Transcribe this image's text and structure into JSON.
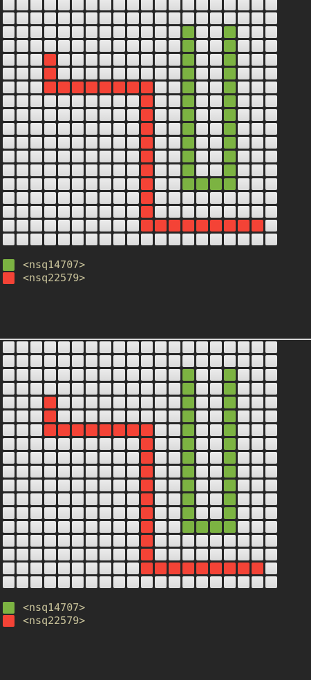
{
  "board": {
    "cols": 20,
    "rows": 18,
    "empty_color": "#e4e4e4"
  },
  "players": [
    {
      "label": "<nsq14707>",
      "color": "#7cb342",
      "cells": [
        [
          13,
          2
        ],
        [
          13,
          3
        ],
        [
          13,
          4
        ],
        [
          13,
          5
        ],
        [
          13,
          6
        ],
        [
          13,
          7
        ],
        [
          13,
          8
        ],
        [
          13,
          9
        ],
        [
          13,
          10
        ],
        [
          13,
          11
        ],
        [
          13,
          12
        ],
        [
          13,
          13
        ],
        [
          14,
          13
        ],
        [
          15,
          13
        ],
        [
          16,
          13
        ],
        [
          16,
          12
        ],
        [
          16,
          11
        ],
        [
          16,
          10
        ],
        [
          16,
          9
        ],
        [
          16,
          8
        ],
        [
          16,
          7
        ],
        [
          16,
          6
        ],
        [
          16,
          5
        ],
        [
          16,
          4
        ],
        [
          16,
          3
        ],
        [
          16,
          2
        ]
      ]
    },
    {
      "label": "<nsq22579>",
      "color": "#f44336",
      "cells": [
        [
          3,
          4
        ],
        [
          3,
          5
        ],
        [
          3,
          6
        ],
        [
          4,
          6
        ],
        [
          5,
          6
        ],
        [
          6,
          6
        ],
        [
          7,
          6
        ],
        [
          8,
          6
        ],
        [
          9,
          6
        ],
        [
          10,
          6
        ],
        [
          10,
          7
        ],
        [
          10,
          8
        ],
        [
          10,
          9
        ],
        [
          10,
          10
        ],
        [
          10,
          11
        ],
        [
          10,
          12
        ],
        [
          10,
          13
        ],
        [
          10,
          14
        ],
        [
          10,
          15
        ],
        [
          11,
          16
        ],
        [
          12,
          16
        ],
        [
          13,
          16
        ],
        [
          14,
          16
        ],
        [
          15,
          16
        ],
        [
          16,
          16
        ],
        [
          17,
          16
        ],
        [
          18,
          16
        ],
        [
          10,
          16
        ]
      ]
    }
  ]
}
